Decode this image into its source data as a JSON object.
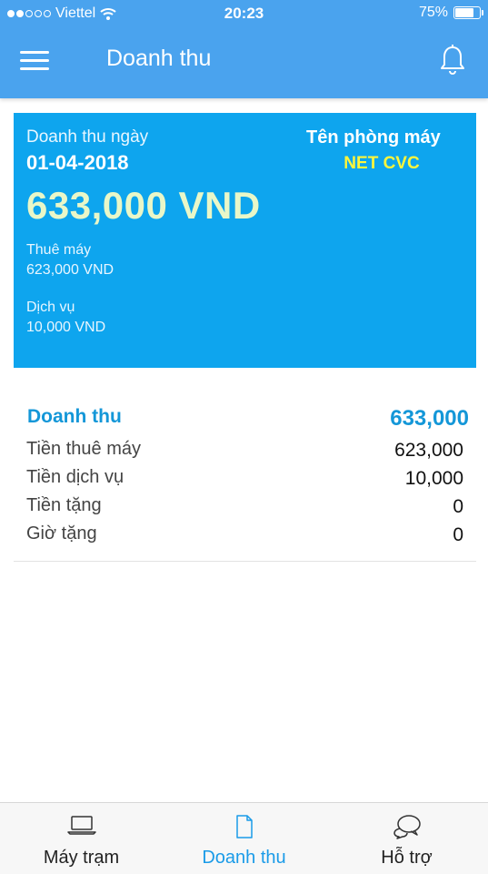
{
  "status_bar": {
    "carrier": "Viettel",
    "time": "20:23",
    "battery": "75%"
  },
  "header": {
    "title": "Doanh thu"
  },
  "card": {
    "label": "Doanh thu ngày",
    "date": "01-04-2018",
    "total": "633,000 VND",
    "rental_label": "Thuê máy",
    "rental_value": "623,000 VND",
    "service_label": "Dịch vụ",
    "service_value": "10,000 VND",
    "room_label": "Tên phòng máy",
    "room_name": "NET CVC"
  },
  "summary": {
    "header_label": "Doanh thu",
    "header_value": "633,000",
    "rows": [
      {
        "label": "Tiền thuê máy",
        "value": "623,000"
      },
      {
        "label": "Tiền dịch vụ",
        "value": "10,000"
      },
      {
        "label": "Tiền tặng",
        "value": "0"
      },
      {
        "label": "Giờ tặng",
        "value": "0"
      }
    ]
  },
  "tabs": [
    {
      "label": "Máy trạm",
      "icon": "laptop-icon"
    },
    {
      "label": "Doanh thu",
      "icon": "document-icon"
    },
    {
      "label": "Hỗ trợ",
      "icon": "chat-bubbles-icon"
    }
  ],
  "colors": {
    "header_blue": "#4aa3ee",
    "card_blue": "#0ea5ee",
    "accent": "#1497d8",
    "total_green": "#e9f7c8",
    "room_yellow": "#fff63a"
  }
}
